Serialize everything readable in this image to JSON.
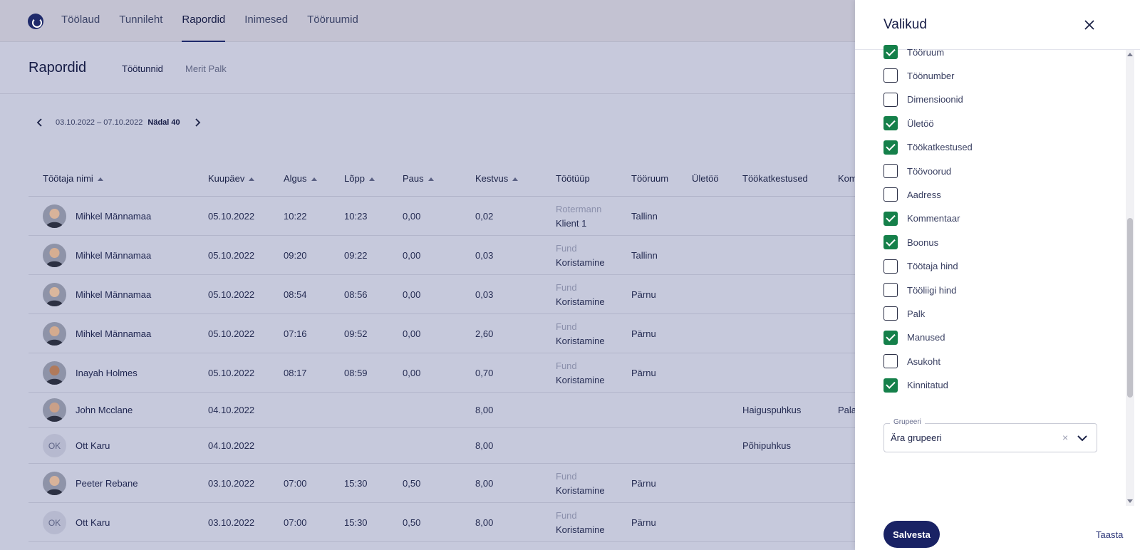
{
  "nav": {
    "items": [
      {
        "label": "Töölaud",
        "active": false
      },
      {
        "label": "Tunnileht",
        "active": false
      },
      {
        "label": "Rapordid",
        "active": true
      },
      {
        "label": "Inimesed",
        "active": false
      },
      {
        "label": "Tööruumid",
        "active": false
      }
    ]
  },
  "page": {
    "title": "Rapordid",
    "subtabs": [
      "Töötunnid",
      "Merit Palk"
    ]
  },
  "week": {
    "range": "03.10.2022 – 07.10.2022",
    "label": "Nädal 40"
  },
  "table": {
    "columns": [
      "Töötaja nimi",
      "Kuupäev",
      "Algus",
      "Lõpp",
      "Paus",
      "Kestvus",
      "Töötüüp",
      "Tööruum",
      "Ületöö",
      "Töökatkestused",
      "Kom"
    ],
    "rows": [
      {
        "avatar": "photo",
        "initials": "",
        "name": "Mihkel Männamaa",
        "date": "05.10.2022",
        "start": "10:22",
        "end": "10:23",
        "pause": "0,00",
        "duration": "0,02",
        "type_top": "Rotermann",
        "type_bottom": "Klient 1",
        "room": "Tallinn",
        "interruption": "",
        "comment": ""
      },
      {
        "avatar": "photo",
        "initials": "",
        "name": "Mihkel Männamaa",
        "date": "05.10.2022",
        "start": "09:20",
        "end": "09:22",
        "pause": "0,00",
        "duration": "0,03",
        "type_top": "Fund",
        "type_bottom": "Koristamine",
        "room": "Tallinn",
        "interruption": "",
        "comment": ""
      },
      {
        "avatar": "photo",
        "initials": "",
        "name": "Mihkel Männamaa",
        "date": "05.10.2022",
        "start": "08:54",
        "end": "08:56",
        "pause": "0,00",
        "duration": "0,03",
        "type_top": "Fund",
        "type_bottom": "Koristamine",
        "room": "Pärnu",
        "interruption": "",
        "comment": ""
      },
      {
        "avatar": "photo",
        "initials": "",
        "name": "Mihkel Männamaa",
        "date": "05.10.2022",
        "start": "07:16",
        "end": "09:52",
        "pause": "0,00",
        "duration": "2,60",
        "type_top": "Fund",
        "type_bottom": "Koristamine",
        "room": "Pärnu",
        "interruption": "",
        "comment": ""
      },
      {
        "avatar": "photo",
        "initials": "",
        "name": "Inayah Holmes",
        "date": "05.10.2022",
        "start": "08:17",
        "end": "08:59",
        "pause": "0,00",
        "duration": "0,70",
        "type_top": "Fund",
        "type_bottom": "Koristamine",
        "room": "Pärnu",
        "interruption": "",
        "comment": ""
      },
      {
        "avatar": "photo",
        "initials": "",
        "name": "John Mcclane",
        "date": "04.10.2022",
        "start": "",
        "end": "",
        "pause": "",
        "duration": "8,00",
        "type_top": "",
        "type_bottom": "",
        "room": "",
        "interruption": "Haiguspuhkus",
        "comment": "Pala"
      },
      {
        "avatar": "initials",
        "initials": "OK",
        "name": "Ott Karu",
        "date": "04.10.2022",
        "start": "",
        "end": "",
        "pause": "",
        "duration": "8,00",
        "type_top": "",
        "type_bottom": "",
        "room": "",
        "interruption": "Põhipuhkus",
        "comment": ""
      },
      {
        "avatar": "photo",
        "initials": "",
        "name": "Peeter Rebane",
        "date": "03.10.2022",
        "start": "07:00",
        "end": "15:30",
        "pause": "0,50",
        "duration": "8,00",
        "type_top": "Fund",
        "type_bottom": "Koristamine",
        "room": "Pärnu",
        "interruption": "",
        "comment": ""
      },
      {
        "avatar": "initials",
        "initials": "OK",
        "name": "Ott Karu",
        "date": "03.10.2022",
        "start": "07:00",
        "end": "15:30",
        "pause": "0,50",
        "duration": "8,00",
        "type_top": "Fund",
        "type_bottom": "Koristamine",
        "room": "Pärnu",
        "interruption": "",
        "comment": ""
      }
    ]
  },
  "panel": {
    "title": "Valikud",
    "options": [
      {
        "label": "Tööruum",
        "checked": true
      },
      {
        "label": "Töönumber",
        "checked": false
      },
      {
        "label": "Dimensioonid",
        "checked": false
      },
      {
        "label": "Ületöö",
        "checked": true
      },
      {
        "label": "Töökatkestused",
        "checked": true
      },
      {
        "label": "Töövoorud",
        "checked": false
      },
      {
        "label": "Aadress",
        "checked": false
      },
      {
        "label": "Kommentaar",
        "checked": true
      },
      {
        "label": "Boonus",
        "checked": true
      },
      {
        "label": "Töötaja hind",
        "checked": false
      },
      {
        "label": "Tööliigi hind",
        "checked": false
      },
      {
        "label": "Palk",
        "checked": false
      },
      {
        "label": "Manused",
        "checked": true
      },
      {
        "label": "Asukoht",
        "checked": false
      },
      {
        "label": "Kinnitatud",
        "checked": true
      }
    ],
    "group": {
      "legend": "Grupeeri",
      "value": "Ära grupeeri",
      "clear": "×"
    },
    "save_label": "Salvesta",
    "reset_label": "Taasta"
  },
  "colors": {
    "checked": "#15804a",
    "primary": "#192264"
  }
}
